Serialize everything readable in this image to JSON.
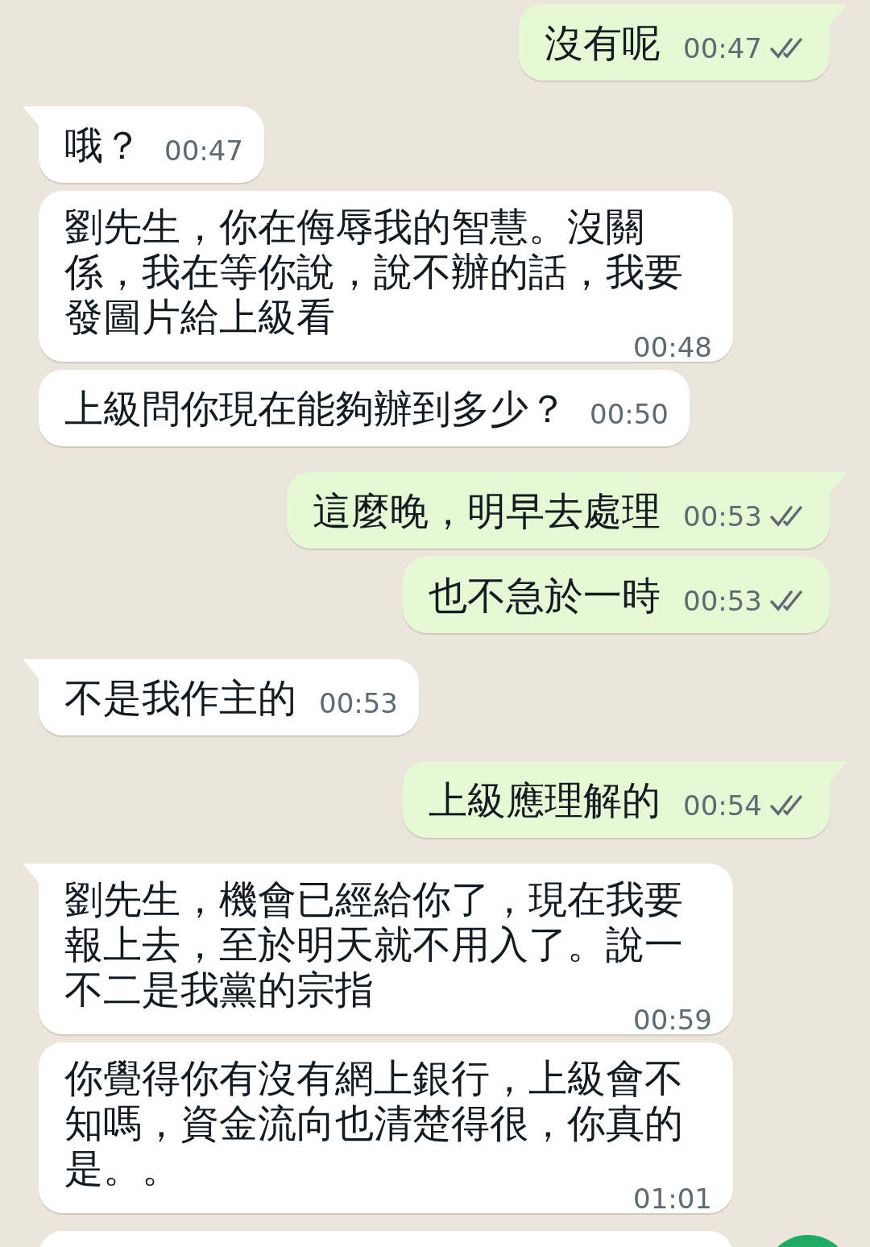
{
  "messages": [
    {
      "kind": "outgoing",
      "tail": true,
      "text": "沒有呢",
      "time": "00:47",
      "read": false
    },
    {
      "kind": "incoming",
      "tail": true,
      "text": "哦？",
      "time": "00:47"
    },
    {
      "kind": "incoming",
      "tail": false,
      "text": "劉先生，你在侮辱我的智慧。沒關係，我在等你說，說不辦的話，我要發圖片給上級看",
      "time": "00:48"
    },
    {
      "kind": "incoming",
      "tail": false,
      "text": "上級問你現在能夠辦到多少？",
      "time": "00:50"
    },
    {
      "kind": "outgoing",
      "tail": true,
      "text": "這麼晚，明早去處理",
      "time": "00:53",
      "read": false
    },
    {
      "kind": "outgoing",
      "tail": false,
      "text": "也不急於一時",
      "time": "00:53",
      "read": false
    },
    {
      "kind": "incoming",
      "tail": true,
      "text": "不是我作主的",
      "time": "00:53"
    },
    {
      "kind": "outgoing",
      "tail": true,
      "text": "上級應理解的",
      "time": "00:54",
      "read": false
    },
    {
      "kind": "incoming",
      "tail": true,
      "text": "劉先生，機會已經給你了，現在我要報上去，至於明天就不用入了。說一不二是我黨的宗指",
      "time": "00:59"
    },
    {
      "kind": "incoming",
      "tail": false,
      "text": "你覺得你有沒有網上銀行，上級會不知嗎，資金流向也清楚得很，你真的是。。",
      "time": "01:01"
    },
    {
      "kind": "cut"
    }
  ]
}
